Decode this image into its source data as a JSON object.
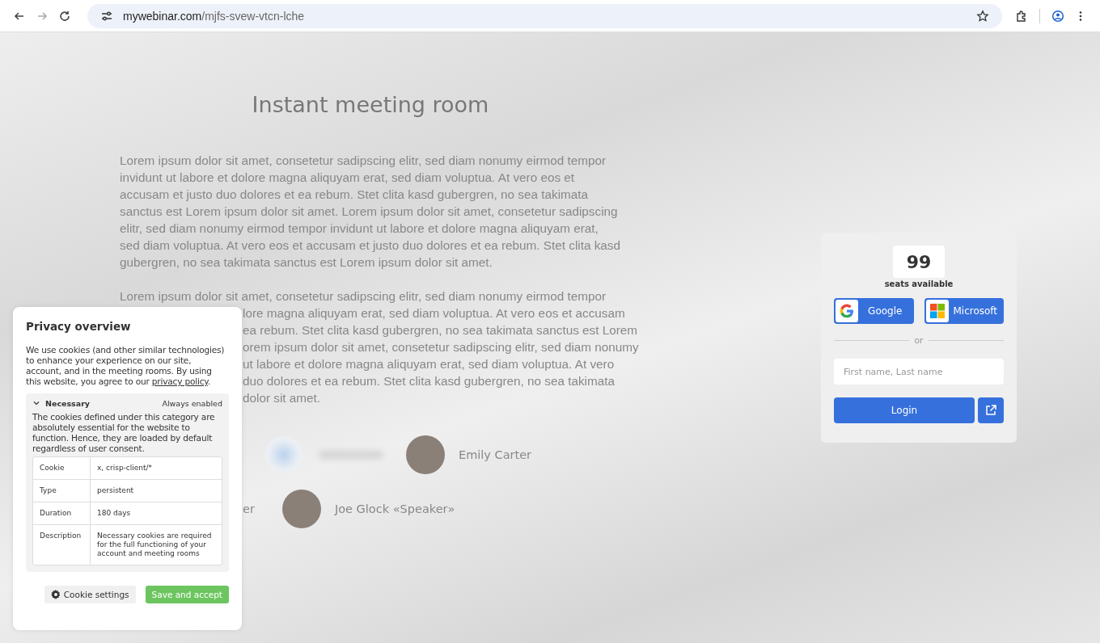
{
  "browser": {
    "url_domain": "mywebinar.com",
    "url_path": "/mjfs-svew-vtcn-lche",
    "forward_disabled": true
  },
  "title": "Instant meeting room",
  "paragraph": "Lorem ipsum dolor sit amet, consetetur sadipscing elitr, sed diam nonumy eirmod tempor invidunt ut labore et dolore magna aliquyam erat, sed diam voluptua. At vero eos et accusam et justo duo dolores et ea rebum. Stet clita kasd gubergren, no sea takimata sanctus est Lorem ipsum dolor sit amet. Lorem ipsum dolor sit amet, consetetur sadipscing elitr, sed diam nonumy eirmod tempor invidunt ut labore et dolore magna aliquyam erat, sed diam voluptua. At vero eos et accusam et justo duo dolores et ea rebum. Stet clita kasd gubergren, no sea takimata sanctus est Lorem ipsum dolor sit amet.",
  "paragraph_2_lines": [
    "Lorem ipsum dolor sit amet, consetetur sadipscing elitr, sed diam nonumy eirmod tempor",
    "lore magna aliquyam erat, sed diam voluptua. At vero eos et accusam",
    "ea rebum. Stet clita kasd gubergren, no sea takimata sanctus est Lorem",
    "orem ipsum dolor sit amet, consetetur sadipscing elitr, sed diam nonumy",
    "ut labore et dolore magna aliquyam erat, sed diam voluptua. At vero",
    "duo dolores et ea rebum. Stet clita kasd gubergren, no sea takimata",
    "dolor sit amet."
  ],
  "speakers": [
    {
      "name": "Emily Carter",
      "kind": "photo"
    },
    {
      "name": "Joe Glock «Speaker»",
      "kind": "photo"
    }
  ],
  "speaker_fragment": "er",
  "login": {
    "seats": "99",
    "seats_label": "seats available",
    "google": "Google",
    "microsoft": "Microsoft",
    "or": "or",
    "name_placeholder": "First name, Last name",
    "login_button": "Login"
  },
  "privacy": {
    "title": "Privacy overview",
    "intro": "We use cookies (and other similar technologies) to enhance your experience on our site, account, and in the meeting rooms. By using this website, you agree to our ",
    "link": "privacy policy",
    "intro_end": ".",
    "category": {
      "name": "Necessary",
      "expanded": true,
      "status": "Always enabled",
      "description": "The cookies defined under this category are absolutely essential for the website to function. Hence, they are loaded by default regardless of user consent.",
      "rows": [
        {
          "label": "Cookie",
          "value": "x, crisp-client/*"
        },
        {
          "label": "Type",
          "value": "persistent"
        },
        {
          "label": "Duration",
          "value": "180 days"
        },
        {
          "label": "Description",
          "value": "Necessary cookies are required for the full functioning of your account and meeting rooms"
        }
      ]
    },
    "settings_button": "Cookie settings",
    "accept_button": "Save and accept"
  }
}
